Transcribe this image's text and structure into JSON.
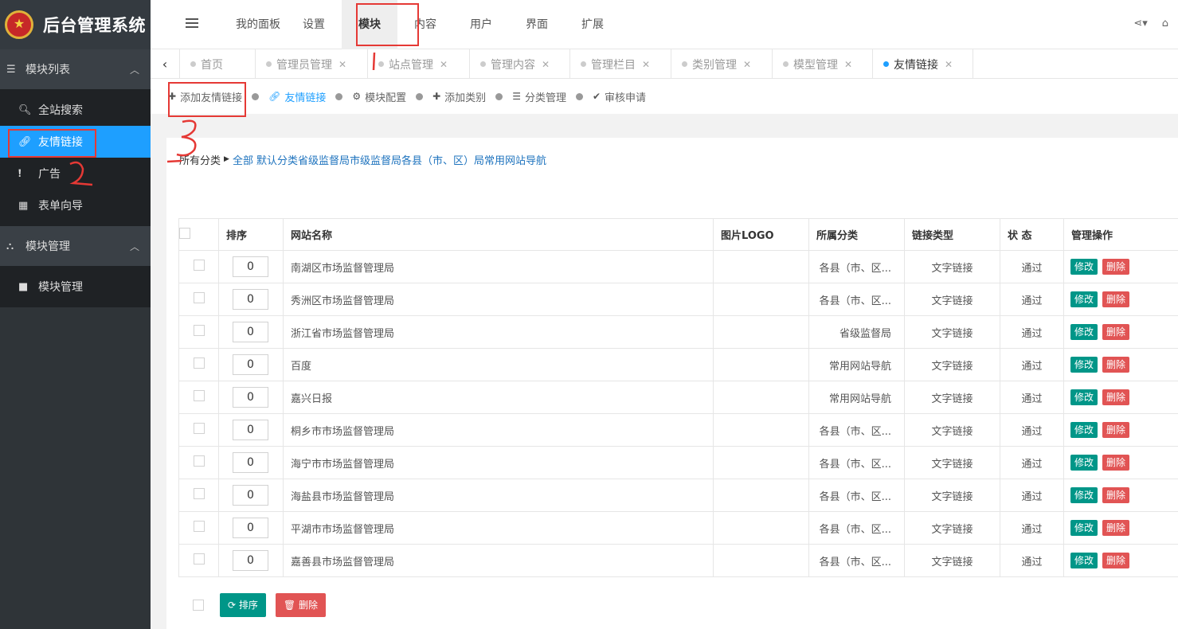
{
  "app": {
    "title": "后台管理系统"
  },
  "sidebar": {
    "groups": [
      {
        "label": "模块列表",
        "items": [
          {
            "label": "全站搜索",
            "icon": "search-icon"
          },
          {
            "label": "友情链接",
            "icon": "link-icon",
            "active": true
          },
          {
            "label": "广告",
            "icon": "exclamation-icon"
          },
          {
            "label": "表单向导",
            "icon": "table-icon"
          }
        ]
      },
      {
        "label": "模块管理",
        "items": [
          {
            "label": "模块管理",
            "icon": "folder-icon"
          }
        ]
      }
    ]
  },
  "topmenu": {
    "items": [
      "我的面板",
      "设置",
      "模块",
      "内容",
      "用户",
      "界面",
      "扩展"
    ],
    "active": "模块"
  },
  "tabs": {
    "items": [
      "首页",
      "管理员管理",
      "站点管理",
      "管理内容",
      "管理栏目",
      "类别管理",
      "模型管理",
      "友情链接"
    ],
    "active": "友情链接"
  },
  "toolbar": {
    "items": [
      "添加友情链接",
      "友情链接",
      "模块配置",
      "添加类别",
      "分类管理",
      "审核申请"
    ],
    "active": "友情链接"
  },
  "breadcrumb": {
    "root": "所有分类",
    "links": [
      "全部",
      "默认分类省级监督局市级监督局各县（市、区）局常用网站导航"
    ]
  },
  "table": {
    "headers": [
      "排序",
      "网站名称",
      "图片LOGO",
      "所属分类",
      "链接类型",
      "状 态",
      "管理操作"
    ],
    "rows": [
      {
        "order": "0",
        "name": "南湖区市场监督管理局",
        "category": "各县（市、区...",
        "type": "文字链接",
        "status": "通过"
      },
      {
        "order": "0",
        "name": "秀洲区市场监督管理局",
        "category": "各县（市、区...",
        "type": "文字链接",
        "status": "通过"
      },
      {
        "order": "0",
        "name": "浙江省市场监督管理局",
        "category": "省级监督局",
        "type": "文字链接",
        "status": "通过"
      },
      {
        "order": "0",
        "name": "百度",
        "category": "常用网站导航",
        "type": "文字链接",
        "status": "通过"
      },
      {
        "order": "0",
        "name": "嘉兴日报",
        "category": "常用网站导航",
        "type": "文字链接",
        "status": "通过"
      },
      {
        "order": "0",
        "name": "桐乡市市场监督管理局",
        "category": "各县（市、区...",
        "type": "文字链接",
        "status": "通过"
      },
      {
        "order": "0",
        "name": "海宁市市场监督管理局",
        "category": "各县（市、区...",
        "type": "文字链接",
        "status": "通过"
      },
      {
        "order": "0",
        "name": "海盐县市场监督管理局",
        "category": "各县（市、区...",
        "type": "文字链接",
        "status": "通过"
      },
      {
        "order": "0",
        "name": "平湖市市场监督管理局",
        "category": "各县（市、区...",
        "type": "文字链接",
        "status": "通过"
      },
      {
        "order": "0",
        "name": "嘉善县市场监督管理局",
        "category": "各县（市、区...",
        "type": "文字链接",
        "status": "通过"
      }
    ],
    "edit_label": "修改",
    "delete_label": "删除"
  },
  "footer": {
    "sort_label": "排序",
    "delete_label": "删除"
  },
  "colors": {
    "sidebar_bg": "#2f3438",
    "active_blue": "#1e9fff",
    "edit_green": "#009688",
    "delete_red": "#e15454",
    "annotation_red": "#e53935"
  }
}
